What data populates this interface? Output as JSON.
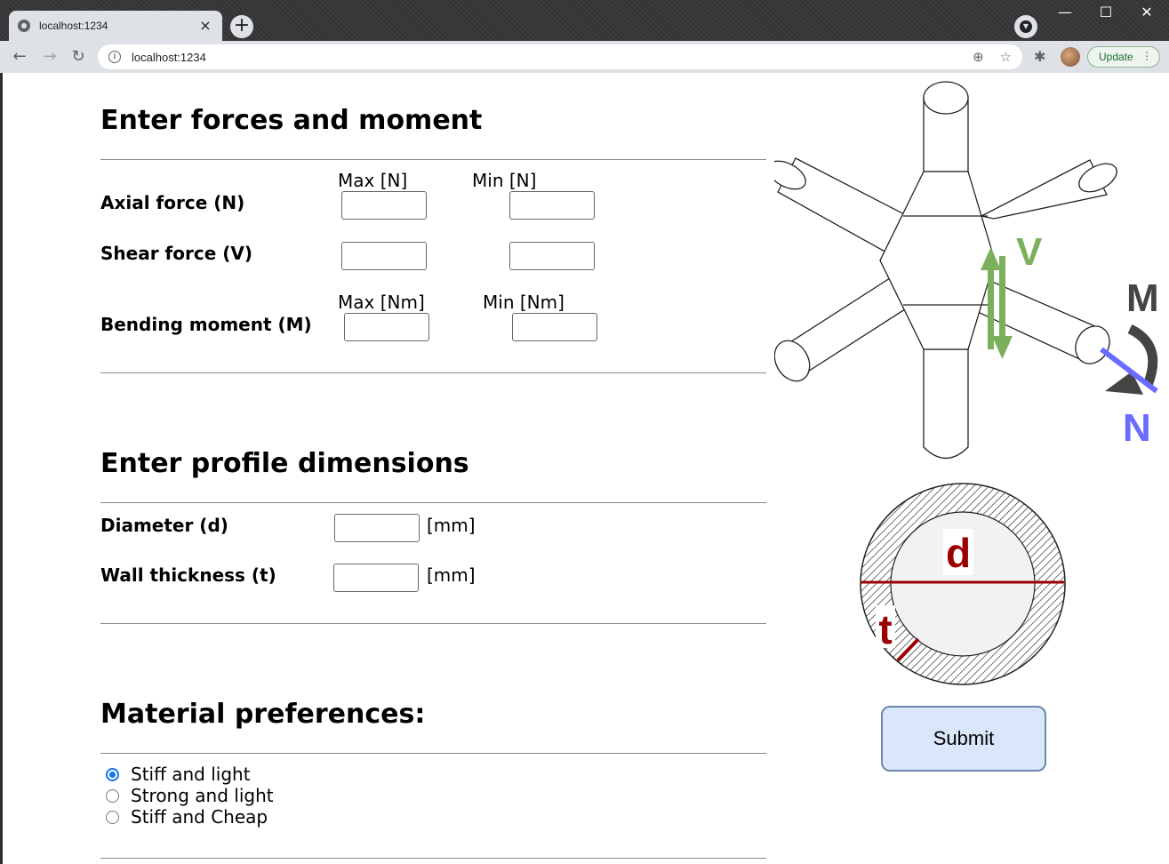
{
  "browser": {
    "tab_title": "localhost:1234",
    "url": "localhost:1234",
    "update_label": "Update"
  },
  "forces": {
    "title": "Enter forces and moment",
    "col_max_n": "Max [N]",
    "col_min_n": "Min [N]",
    "col_max_nm": "Max [Nm]",
    "col_min_nm": "Min [Nm]",
    "axial_label": "Axial force (N)",
    "shear_label": "Shear force (V)",
    "bending_label": "Bending moment (M)",
    "axial_max": "",
    "axial_min": "",
    "shear_max": "",
    "shear_min": "",
    "bending_max": "",
    "bending_min": ""
  },
  "profile": {
    "title": "Enter profile dimensions",
    "diameter_label": "Diameter (d)",
    "thickness_label": "Wall thickness (t)",
    "unit": "[mm]",
    "diameter_value": "",
    "thickness_value": ""
  },
  "material": {
    "title": "Material preferences:",
    "options": [
      "Stiff and light",
      "Strong and light",
      "Stiff and Cheap"
    ],
    "selected": "Stiff and light"
  },
  "diagram": {
    "label_v": "V",
    "label_m": "M",
    "label_n": "N",
    "label_d": "d",
    "label_t": "t",
    "color_v": "#7ab05c",
    "color_n": "#6a6cff",
    "color_dim": "#9b0000"
  },
  "submit_label": "Submit"
}
